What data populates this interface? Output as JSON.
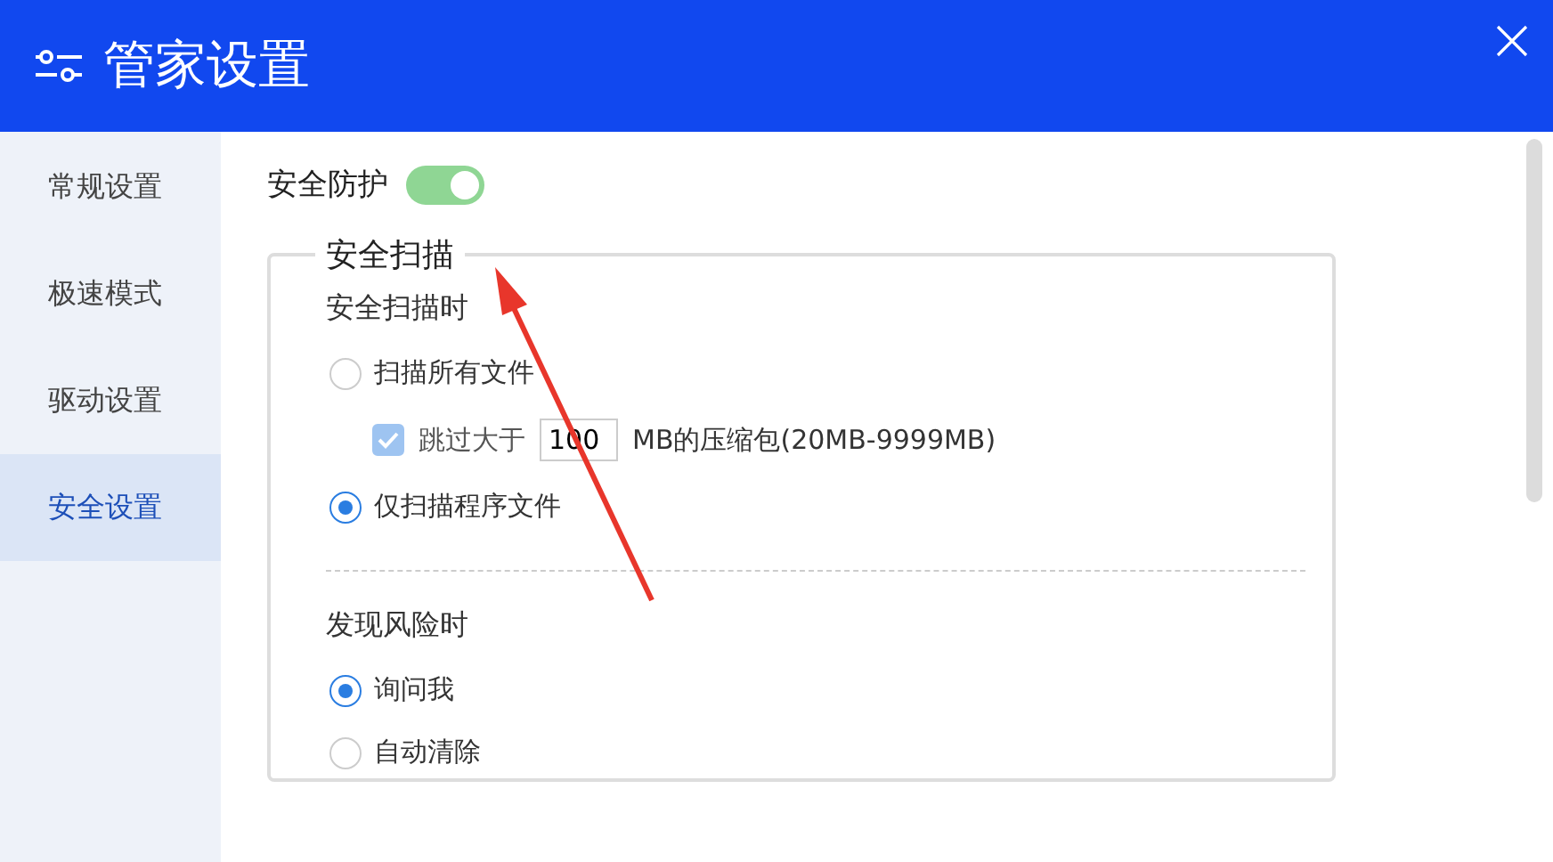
{
  "window": {
    "title": "管家设置"
  },
  "sidebar": {
    "items": [
      {
        "label": "常规设置",
        "selected": false
      },
      {
        "label": "极速模式",
        "selected": false
      },
      {
        "label": "驱动设置",
        "selected": false
      },
      {
        "label": "安全设置",
        "selected": true
      }
    ]
  },
  "protection": {
    "label": "安全防护",
    "on": true
  },
  "scan_section": {
    "title": "安全扫描",
    "groups": [
      {
        "title": "安全扫描时",
        "options": [
          {
            "label": "扫描所有文件",
            "selected": false,
            "sub": {
              "checked": true,
              "disabled": true,
              "prefix": "跳过大于",
              "value": "100",
              "suffix": "MB的压缩包(20MB-9999MB)"
            }
          },
          {
            "label": "仅扫描程序文件",
            "selected": true
          }
        ]
      },
      {
        "title": "发现风险时",
        "options": [
          {
            "label": "询问我",
            "selected": true
          },
          {
            "label": "自动清除",
            "selected": false
          }
        ]
      }
    ]
  }
}
